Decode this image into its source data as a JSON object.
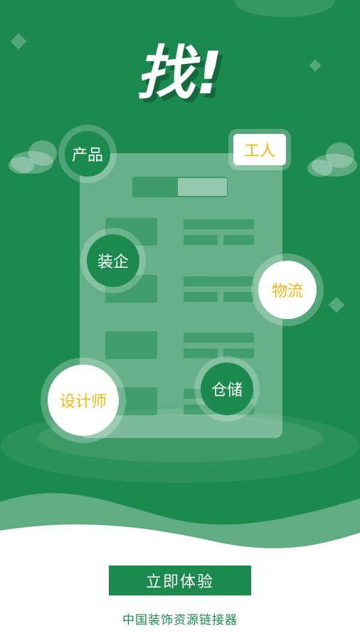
{
  "hero": {
    "title": "找!",
    "categories": {
      "product": "产品",
      "worker": "工人",
      "decoration_company": "装企",
      "logistics": "物流",
      "designer": "设计师",
      "warehouse": "仓储"
    },
    "icons": [
      "cloud-icon",
      "diamond-icon",
      "document-illustration"
    ]
  },
  "cta": {
    "label": "立即体验"
  },
  "footer": {
    "text": "中国装饰资源链接器"
  },
  "colors": {
    "brand_green": "#1c8a4f",
    "accent_yellow": "#f3b711",
    "background": "#ffffff"
  }
}
